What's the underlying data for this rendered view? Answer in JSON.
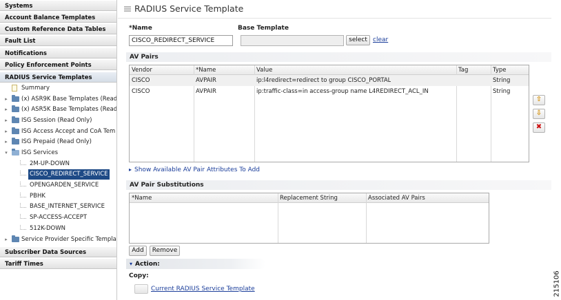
{
  "sidebar": {
    "top_items": [
      "Systems",
      "Account Balance Templates",
      "Custom Reference Data Tables",
      "Fault List",
      "Notifications",
      "Policy Enforcement Points"
    ],
    "active_item": "RADIUS Service Templates",
    "tree": {
      "summary": "Summary",
      "folders": [
        "(x) ASR9K Base Templates (Read",
        "(x) ASR5K Base Templates (Read",
        "ISG Session (Read Only)",
        "ISG Access Accept and CoA Tem",
        "ISG Prepaid (Read Only)"
      ],
      "open_folder": "ISG Services",
      "services": [
        "2M-UP-DOWN",
        "CISCO_REDIRECT_SERVICE",
        "OPENGARDEN_SERVICE",
        "PBHK",
        "BASE_INTERNET_SERVICE",
        "SP-ACCESS-ACCEPT",
        "512K-DOWN"
      ],
      "selected_service": "CISCO_REDIRECT_SERVICE",
      "last_folder": "Service Provider Specific Templat"
    },
    "bottom_items": [
      "Subscriber Data Sources",
      "Tariff Times"
    ]
  },
  "page": {
    "title": "RADIUS Service Template",
    "name_label": "*Name",
    "name_value": "CISCO_REDIRECT_SERVICE",
    "base_template_label": "Base Template",
    "base_template_value": "",
    "select_label": "select",
    "clear_label": "clear"
  },
  "av_pairs": {
    "title": "AV Pairs",
    "columns": [
      "Vendor",
      "*Name",
      "Value",
      "Tag",
      "Type"
    ],
    "rows": [
      [
        "CISCO",
        "AVPAIR",
        "ip:l4redirect=redirect to group CISCO_PORTAL",
        "",
        "String"
      ],
      [
        "CISCO",
        "AVPAIR",
        "ip:traffic-class=in access-group name L4REDIRECT_ACL_IN",
        "",
        "String"
      ]
    ],
    "show_link": "Show Available AV Pair Attributes To Add"
  },
  "substitutions": {
    "title": "AV Pair Substitutions",
    "columns": [
      "*Name",
      "Replacement String",
      "Associated AV Pairs"
    ],
    "add_label": "Add",
    "remove_label": "Remove"
  },
  "action": {
    "title": "Action:",
    "copy_label": "Copy:",
    "copy_link": "Current RADIUS Service Template"
  },
  "figure_id": "215106",
  "colors": {
    "selected_bg": "#1e4a86",
    "link": "#1a3d9a",
    "folder": "#5e86b2"
  }
}
